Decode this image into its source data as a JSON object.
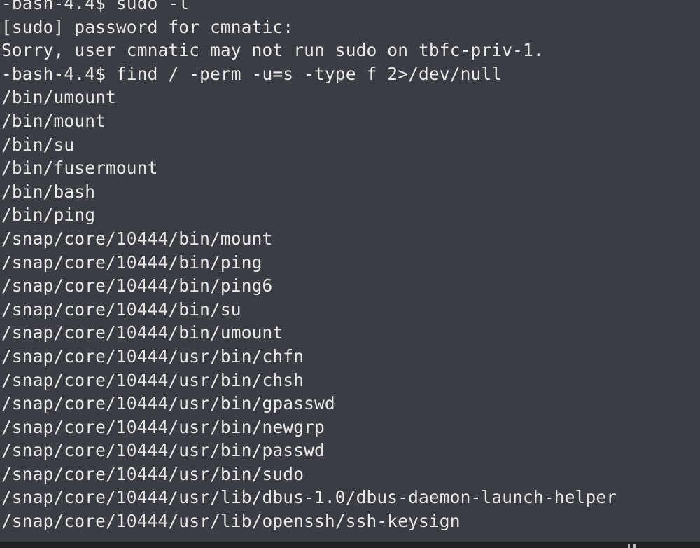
{
  "terminal": {
    "lines": [
      "-bash-4.4$ sudo -l",
      "[sudo] password for cmnatic:",
      "Sorry, user cmnatic may not run sudo on tbfc-priv-1.",
      "-bash-4.4$ find / -perm -u=s -type f 2>/dev/null",
      "/bin/umount",
      "/bin/mount",
      "/bin/su",
      "/bin/fusermount",
      "/bin/bash",
      "/bin/ping",
      "/snap/core/10444/bin/mount",
      "/snap/core/10444/bin/ping",
      "/snap/core/10444/bin/ping6",
      "/snap/core/10444/bin/su",
      "/snap/core/10444/bin/umount",
      "/snap/core/10444/usr/bin/chfn",
      "/snap/core/10444/usr/bin/chsh",
      "/snap/core/10444/usr/bin/gpasswd",
      "/snap/core/10444/usr/bin/newgrp",
      "/snap/core/10444/usr/bin/passwd",
      "/snap/core/10444/usr/bin/sudo",
      "/snap/core/10444/usr/lib/dbus-1.0/dbus-daemon-launch-helper",
      "/snap/core/10444/usr/lib/openssh/ssh-keysign"
    ]
  },
  "colors": {
    "background": "#3a3d44",
    "text": "#e9e9e9"
  }
}
